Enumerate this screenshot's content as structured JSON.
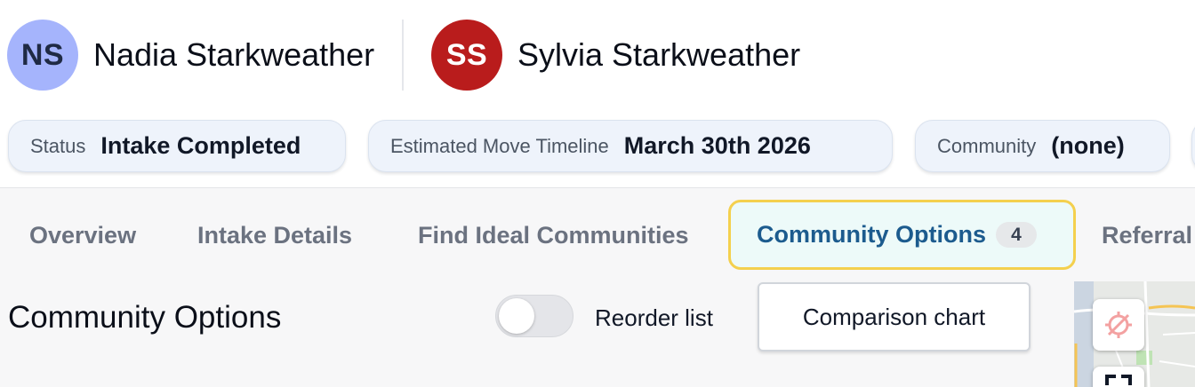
{
  "people": [
    {
      "initials": "NS",
      "name": "Nadia Starkweather",
      "avatar_color": "#a5b4fc"
    },
    {
      "initials": "SS",
      "name": "Sylvia Starkweather",
      "avatar_color": "#b91c1c"
    }
  ],
  "info_pills": {
    "status": {
      "label": "Status",
      "value": "Intake Completed"
    },
    "timeline": {
      "label": "Estimated Move Timeline",
      "value": "March 30th 2026"
    },
    "community": {
      "label": "Community",
      "value": "(none)"
    }
  },
  "tabs": [
    {
      "label": "Overview"
    },
    {
      "label": "Intake Details"
    },
    {
      "label": "Find Ideal Communities"
    },
    {
      "label": "Community Options",
      "count": "4",
      "active": true
    },
    {
      "label": "Referral"
    }
  ],
  "section": {
    "title": "Community Options",
    "reorder_label": "Reorder list",
    "reorder_enabled": false,
    "comparison_button": "Comparison chart"
  },
  "map": {
    "controls": [
      "location-off-icon",
      "fullscreen-icon"
    ]
  },
  "colors": {
    "active_tab_border": "#f4d04e",
    "active_tab_text": "#1c5b8e",
    "pill_background": "#eef3fb"
  }
}
